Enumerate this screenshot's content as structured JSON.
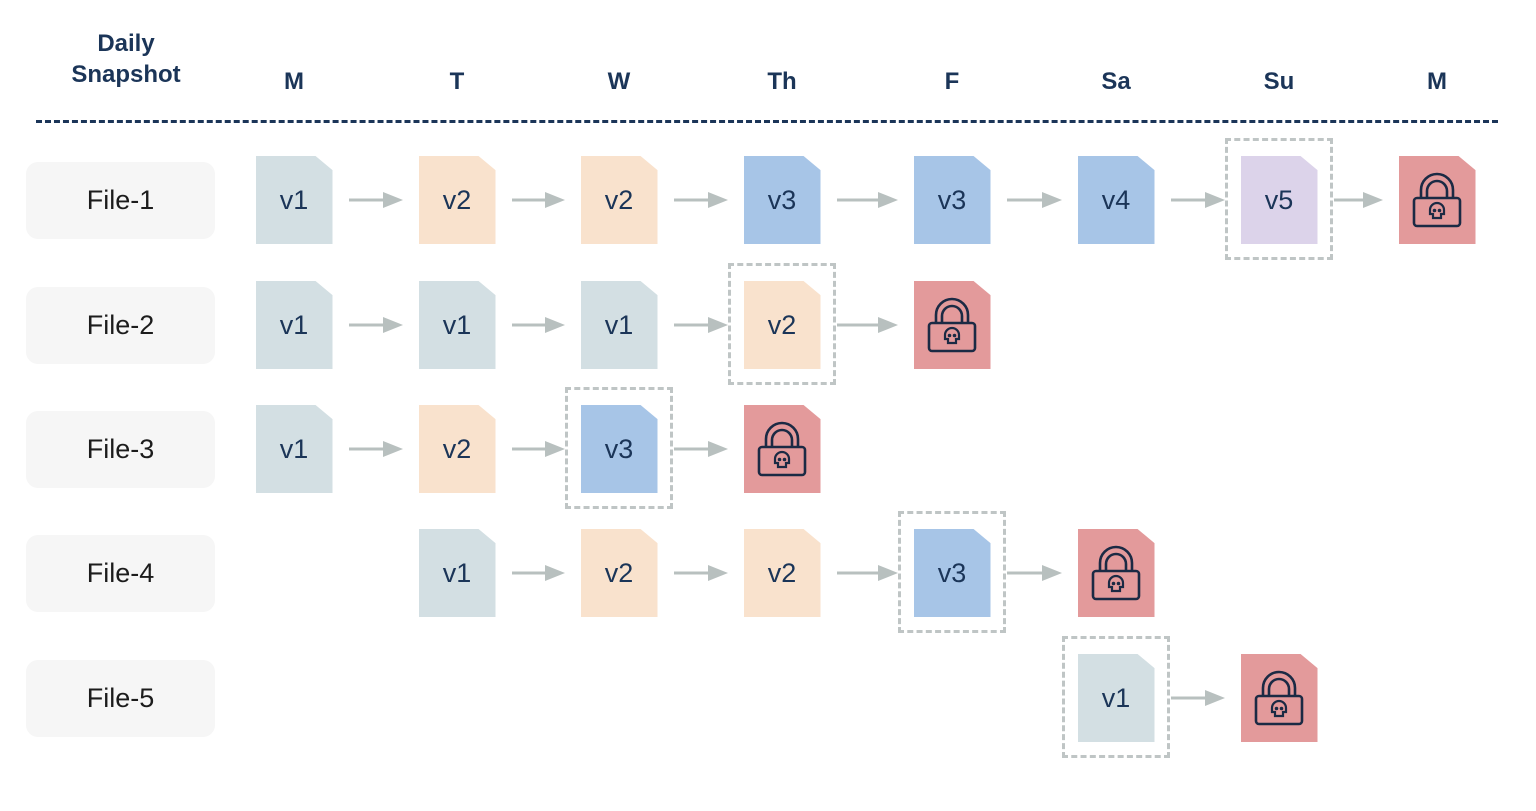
{
  "header": {
    "title_line1": "Daily",
    "title_line2": "Snapshot",
    "days": [
      "M",
      "T",
      "W",
      "Th",
      "F",
      "Sa",
      "Su",
      "M"
    ]
  },
  "version_colors": {
    "v1": "#d3dfe3",
    "v2": "#f9e2cd",
    "v3": "#a7c5e7",
    "v4": "#a7c5e7",
    "v5": "#dcd3ea",
    "encrypted": "#e39a9b"
  },
  "icons": {
    "encrypted": "lock-skull-icon",
    "arrow": "arrow-right-icon"
  },
  "files": [
    {
      "label": "File-1",
      "cells": [
        {
          "day": 0,
          "version": "v1"
        },
        {
          "day": 1,
          "version": "v2"
        },
        {
          "day": 2,
          "version": "v2"
        },
        {
          "day": 3,
          "version": "v3"
        },
        {
          "day": 4,
          "version": "v3"
        },
        {
          "day": 5,
          "version": "v4"
        },
        {
          "day": 6,
          "version": "v5",
          "highlighted": true
        },
        {
          "day": 7,
          "version": "encrypted"
        }
      ]
    },
    {
      "label": "File-2",
      "cells": [
        {
          "day": 0,
          "version": "v1"
        },
        {
          "day": 1,
          "version": "v1"
        },
        {
          "day": 2,
          "version": "v1"
        },
        {
          "day": 3,
          "version": "v2",
          "highlighted": true
        },
        {
          "day": 4,
          "version": "encrypted"
        }
      ]
    },
    {
      "label": "File-3",
      "cells": [
        {
          "day": 0,
          "version": "v1"
        },
        {
          "day": 1,
          "version": "v2"
        },
        {
          "day": 2,
          "version": "v3",
          "highlighted": true
        },
        {
          "day": 3,
          "version": "encrypted"
        }
      ]
    },
    {
      "label": "File-4",
      "cells": [
        {
          "day": 1,
          "version": "v1"
        },
        {
          "day": 2,
          "version": "v2"
        },
        {
          "day": 3,
          "version": "v2"
        },
        {
          "day": 4,
          "version": "v3",
          "highlighted": true
        },
        {
          "day": 5,
          "version": "encrypted"
        }
      ]
    },
    {
      "label": "File-5",
      "cells": [
        {
          "day": 5,
          "version": "v1",
          "highlighted": true
        },
        {
          "day": 6,
          "version": "encrypted"
        }
      ]
    }
  ]
}
